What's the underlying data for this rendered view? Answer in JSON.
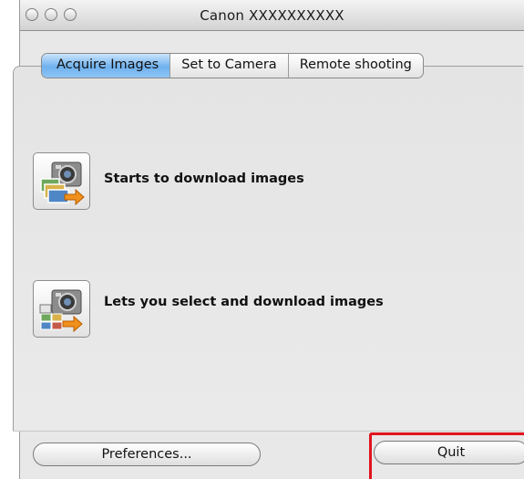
{
  "window": {
    "title": "Canon XXXXXXXXXX"
  },
  "tabs": [
    {
      "label": "Acquire Images",
      "active": true
    },
    {
      "label": "Set to Camera",
      "active": false
    },
    {
      "label": "Remote shooting",
      "active": false
    }
  ],
  "actions": [
    {
      "label": "Starts to download images",
      "icon": "camera-download-icon"
    },
    {
      "label": "Lets you select and download images",
      "icon": "camera-select-download-icon"
    }
  ],
  "footer": {
    "preferences_label": "Preferences...",
    "quit_label": "Quit"
  },
  "colors": {
    "active_tab": "#6fb1ef",
    "highlight": "#e0141e",
    "window_bg": "#e8e8e8"
  }
}
